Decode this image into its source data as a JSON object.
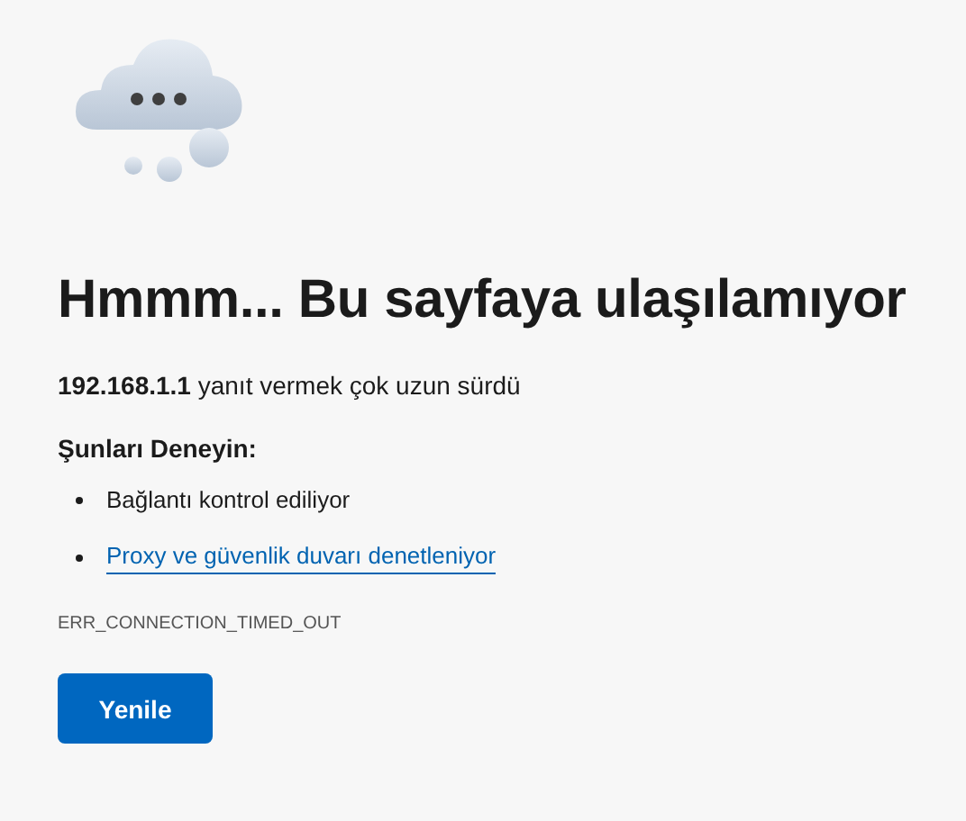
{
  "heading": "Hmmm... Bu sayfaya ulaşılamıyor",
  "message": "**192.168.1.1** yanıt vermek çok uzun sürdü",
  "suggestions_title": "Şunları Deneyin:",
  "suggestions": [
    {
      "kind": "text",
      "text": "Bağlantı kontrol ediliyor"
    },
    {
      "kind": "link",
      "text": "Proxy ve güvenlik duvarı denetleniyor"
    }
  ],
  "error_code": "ERR_CONNECTION_TIMED_OUT",
  "button": "Yenile"
}
